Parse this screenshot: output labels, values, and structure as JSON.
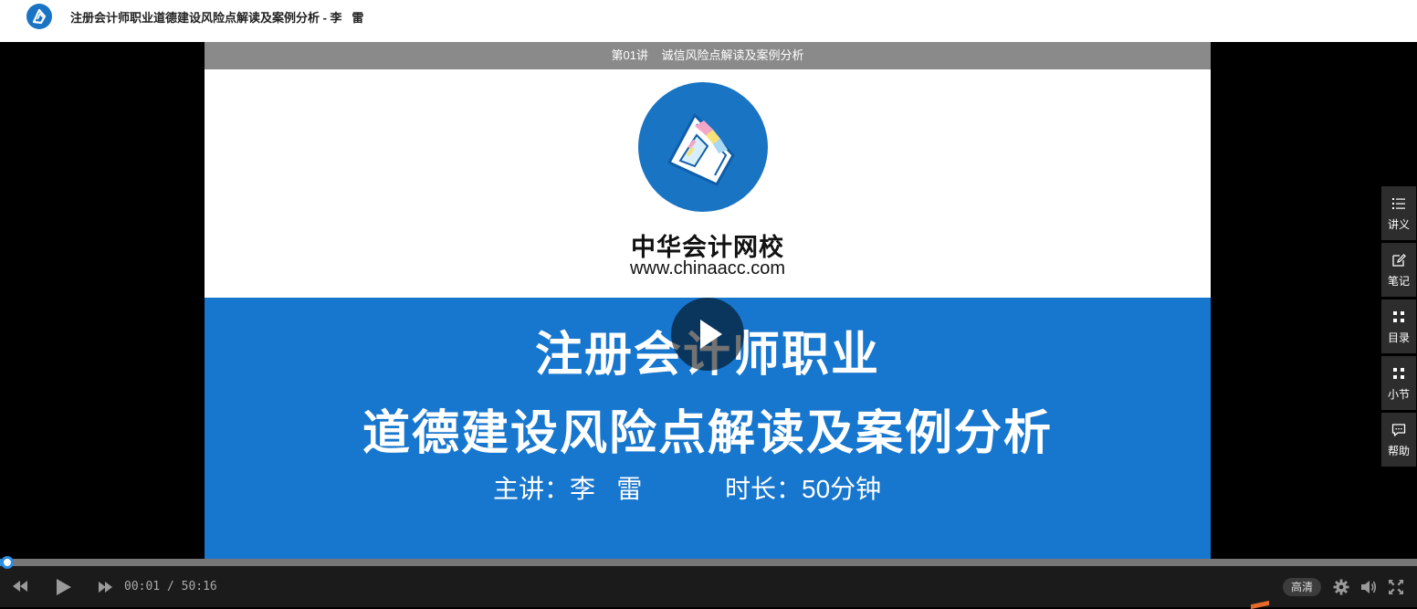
{
  "header": {
    "title": "注册会计师职业道德建设风险点解读及案例分析 - 李   雷"
  },
  "video": {
    "lecture_label": "第01讲    诚信风险点解读及案例分析",
    "brand_name": "中华会计网校",
    "brand_url": "www.chinaacc.com",
    "slide_title_line1": "注册会计师职业",
    "slide_title_line2": "道德建设风险点解读及案例分析",
    "presenter": "主讲：李   雷",
    "duration": "时长：50分钟"
  },
  "side_menu": {
    "items": [
      {
        "label": "讲义",
        "icon": "list-icon"
      },
      {
        "label": "笔记",
        "icon": "edit-icon"
      },
      {
        "label": "目录",
        "icon": "grid-icon"
      },
      {
        "label": "小节",
        "icon": "grid-icon"
      },
      {
        "label": "帮助",
        "icon": "chat-icon"
      }
    ]
  },
  "player": {
    "current_time": "00:01",
    "separator": " / ",
    "total_time": "50:16",
    "progress_fraction": 0.0003,
    "quality_label": "高清"
  },
  "colors": {
    "brand_blue": "#1776cd",
    "progress_blue": "#2c8ce0",
    "lecture_bar": "#8a8a8a"
  }
}
